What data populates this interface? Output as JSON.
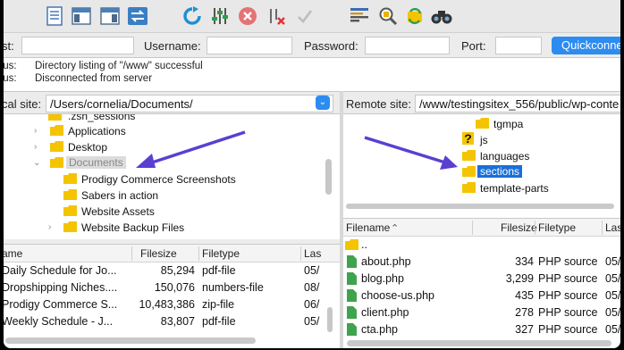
{
  "colors": {
    "accent": "#2d8cf0",
    "folder": "#f5c400",
    "arrow": "#5a3fd1",
    "php": "#3fa34d"
  },
  "toolbar": {
    "icons": [
      "site-manager-icon",
      "toggle-log-icon",
      "toggle-local-tree-icon",
      "toggle-remote-tree-icon",
      "transfer-queue-icon",
      "refresh-icon",
      "process-queue-icon",
      "cancel-icon",
      "disconnect-icon",
      "reconnect-icon",
      "filter-icon",
      "search-icon",
      "sync-browse-icon",
      "compare-icon"
    ]
  },
  "connect": {
    "host_label": "st:",
    "username_label": "Username:",
    "password_label": "Password:",
    "port_label": "Port:",
    "host_value": "",
    "username_value": "",
    "password_value": "",
    "port_value": "",
    "quickconnect_label": "Quickconnect"
  },
  "log": [
    {
      "key": "tus:",
      "value": "Directory listing of \"/www\" successful"
    },
    {
      "key": "tus:",
      "value": "Disconnected from server"
    }
  ],
  "local": {
    "label": "cal site:",
    "path": "/Users/cornelia/Documents/",
    "tree": [
      {
        "name": ".zsh_sessions",
        "chevron": ""
      },
      {
        "name": "Applications",
        "chevron": "›"
      },
      {
        "name": "Desktop",
        "chevron": "›"
      },
      {
        "name": "Documents",
        "chevron": "⌄"
      },
      {
        "name": "Prodigy Commerce Screenshots",
        "chevron": ""
      },
      {
        "name": "Sabers in action",
        "chevron": ""
      },
      {
        "name": "Website Assets",
        "chevron": ""
      },
      {
        "name": "Website Backup Files",
        "chevron": "›"
      }
    ],
    "columns": {
      "name": "ame",
      "size": "Filesize",
      "type": "Filetype",
      "modified": "Las"
    },
    "files": [
      {
        "name": "Daily Schedule for Jo...",
        "size": "85,294",
        "type": "pdf-file",
        "modified": "05/"
      },
      {
        "name": "Dropshipping Niches....",
        "size": "150,076",
        "type": "numbers-file",
        "modified": "08/"
      },
      {
        "name": "Prodigy Commerce S...",
        "size": "10,483,386",
        "type": "zip-file",
        "modified": "06/"
      },
      {
        "name": "Weekly Schedule - J...",
        "size": "83,807",
        "type": "pdf-file",
        "modified": "05/"
      }
    ]
  },
  "remote": {
    "label": "Remote site:",
    "path": "/www/testingsitex_556/public/wp-conte",
    "tree": [
      {
        "name": "tgmpa",
        "icon": "folder"
      },
      {
        "name": "js",
        "icon": "unknown"
      },
      {
        "name": "languages",
        "icon": "folder"
      },
      {
        "name": "sections",
        "icon": "folder"
      },
      {
        "name": "template-parts",
        "icon": "folder"
      }
    ],
    "columns": {
      "name": "Filename",
      "size": "Filesize",
      "type": "Filetype",
      "perms": "Las"
    },
    "files": [
      {
        "name": "..",
        "size": "",
        "type": "",
        "modified": ""
      },
      {
        "name": "about.php",
        "size": "334",
        "type": "PHP source",
        "modified": "05/"
      },
      {
        "name": "blog.php",
        "size": "3,299",
        "type": "PHP source",
        "modified": "05/"
      },
      {
        "name": "choose-us.php",
        "size": "435",
        "type": "PHP source",
        "modified": "05/"
      },
      {
        "name": "client.php",
        "size": "278",
        "type": "PHP source",
        "modified": "05/"
      },
      {
        "name": "cta.php",
        "size": "327",
        "type": "PHP source",
        "modified": "05/"
      }
    ]
  }
}
